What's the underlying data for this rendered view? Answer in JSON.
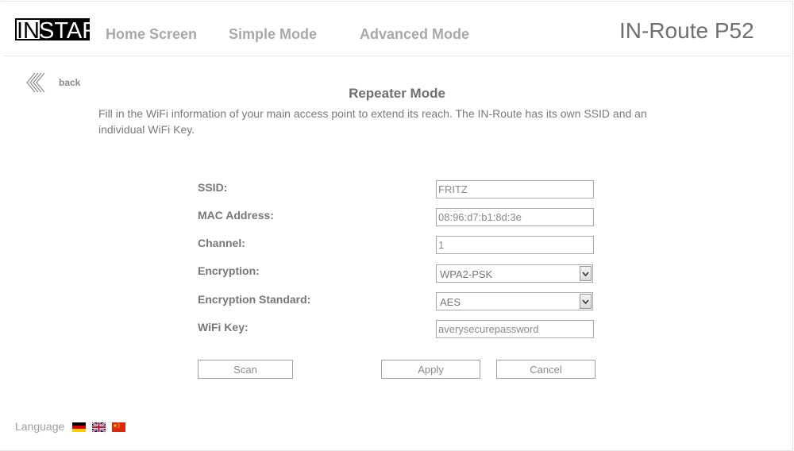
{
  "header": {
    "logo_text_in": "IN",
    "logo_text_star": "STAR",
    "nav": {
      "home": "Home Screen",
      "simple": "Simple Mode",
      "advanced": "Advanced Mode"
    },
    "product_name": "IN-Route P52"
  },
  "back_label": "back",
  "page": {
    "title": "Repeater Mode",
    "description": "Fill in the WiFi information of your main access point to extend its reach. The IN-Route has its own SSID and an individual WiFi Key."
  },
  "form": {
    "ssid_label": "SSID:",
    "ssid_value": "FRITZ",
    "mac_label": "MAC Address:",
    "mac_value": "08:96:d7:b1:8d:3e",
    "channel_label": "Channel:",
    "channel_value": "1",
    "encryption_label": "Encryption:",
    "encryption_value": "WPA2-PSK",
    "standard_label": "Encryption Standard:",
    "standard_value": "AES",
    "wifikey_label": "WiFi Key:",
    "wifikey_value": "averysecurepassword"
  },
  "buttons": {
    "scan": "Scan",
    "apply": "Apply",
    "cancel": "Cancel"
  },
  "language": {
    "label": "Language",
    "flags": [
      "german-flag-icon",
      "uk-flag-icon",
      "china-flag-icon"
    ]
  },
  "colors": {
    "nav_text": "#a8a8a8",
    "logo_black": "#000000",
    "flag_red": "#de2910"
  }
}
